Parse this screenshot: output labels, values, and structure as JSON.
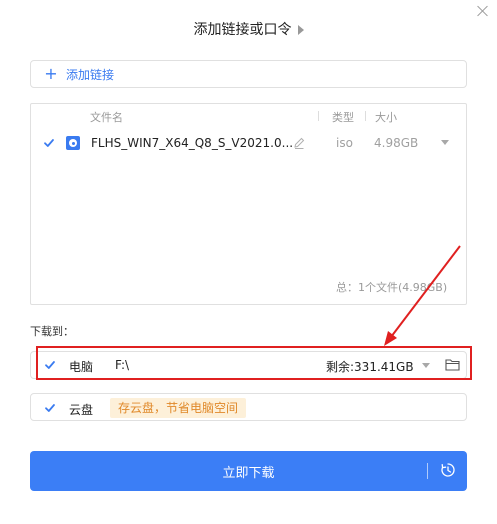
{
  "dialog": {
    "title": "添加链接或口令"
  },
  "add_link": {
    "label": "添加链接"
  },
  "file_table": {
    "headers": {
      "name": "文件名",
      "type": "类型",
      "size": "大小"
    },
    "rows": [
      {
        "name": "FLHS_WIN7_X64_Q8_S_V2021.0...",
        "type": "iso",
        "size": "4.98GB",
        "checked": true
      }
    ],
    "total": "总：1个文件(4.98GB)"
  },
  "download_to": {
    "label": "下载到：",
    "pc": {
      "label": "电脑",
      "path": "F:\\",
      "free_space": "剩余:331.41GB",
      "checked": true
    },
    "cloud": {
      "label": "云盘",
      "promo": "存云盘，节省电脑空间",
      "checked": true
    }
  },
  "download_button": {
    "label": "立即下载"
  },
  "colors": {
    "accent": "#3b7ef6",
    "highlight": "#e02020",
    "promo_bg": "#fdf0d9",
    "promo_text": "#e0892a"
  }
}
